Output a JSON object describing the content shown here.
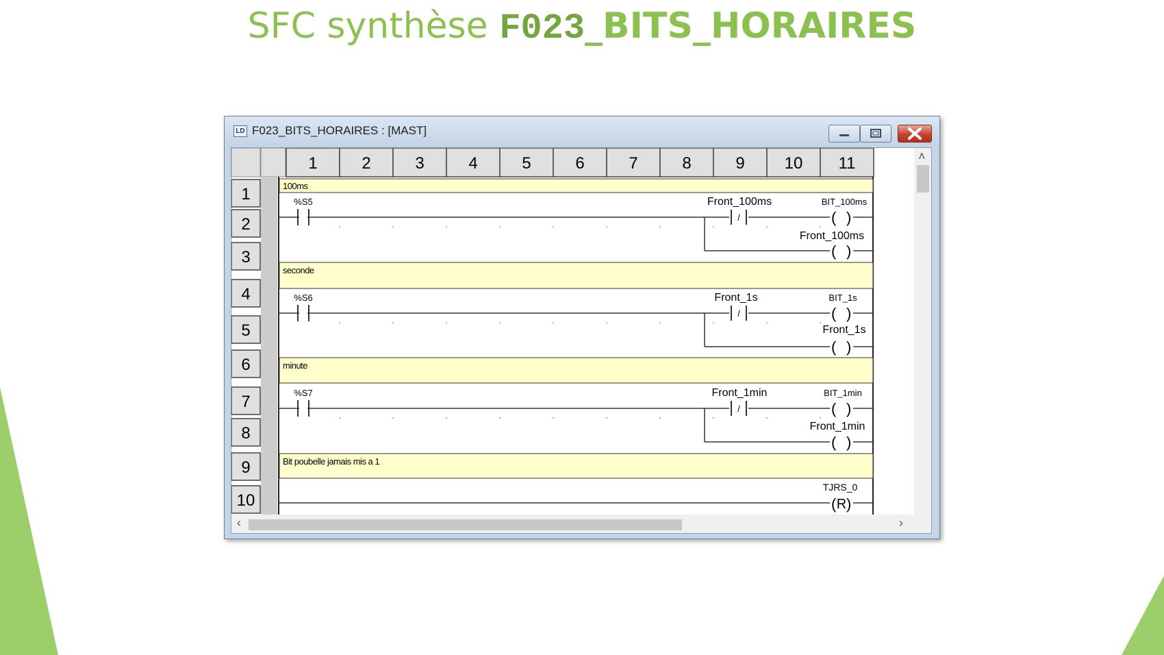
{
  "slide": {
    "title_part1": "SFC synthèse ",
    "title_part2": "F023",
    "title_part3": "_BITS_HORAIRES"
  },
  "window": {
    "title": "F023_BITS_HORAIRES : [MAST]",
    "min_icon": "minimize-icon",
    "max_icon": "maximize-icon",
    "close_icon": "close-icon",
    "app_icon": "ladder-editor-icon"
  },
  "grid": {
    "columns": [
      "1",
      "2",
      "3",
      "4",
      "5",
      "6",
      "7",
      "8",
      "9",
      "10",
      "11"
    ],
    "rows": [
      "1",
      "2",
      "3",
      "4",
      "5",
      "6",
      "7",
      "8",
      "9",
      "10"
    ]
  },
  "comments": [
    "100ms",
    "seconde",
    "minute",
    "Bit poubelle jamais mis a 1"
  ],
  "rungs": [
    {
      "contact": "%S5",
      "nc_contact": "Front_100ms",
      "coil": "BIT_100ms",
      "coil2": "Front_100ms"
    },
    {
      "contact": "%S6",
      "nc_contact": "Front_1s",
      "coil": "BIT_1s",
      "coil2": "Front_1s"
    },
    {
      "contact": "%S7",
      "nc_contact": "Front_1min",
      "coil": "BIT_1min",
      "coil2": "Front_1min"
    }
  ],
  "reset_rung": {
    "coil": "TJRS_0",
    "coil_letter": "R"
  },
  "glyphs": {
    "nc_slash": "/",
    "paren_open": "(",
    "paren_close": ")"
  },
  "scroll": {
    "left_arrow": "‹",
    "right_arrow": "›",
    "up_arrow": "˄"
  },
  "colors": {
    "title_green": "#8cc152",
    "title_dark_green": "#73a63f",
    "comment_fill": "#ffffcc",
    "deco_green": "#9ccf6a"
  }
}
